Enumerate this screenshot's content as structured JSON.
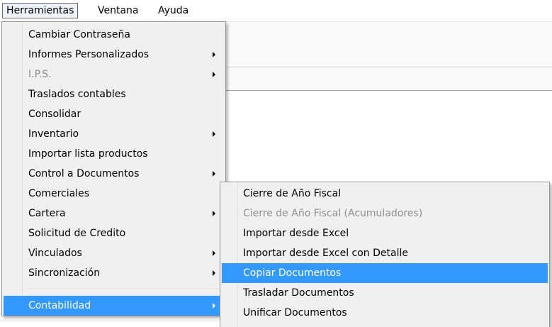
{
  "menubar": {
    "items": [
      {
        "label": "Herramientas"
      },
      {
        "label": "Ventana"
      },
      {
        "label": "Ayuda"
      }
    ]
  },
  "herramientas_menu": {
    "items": [
      {
        "label": "Cambiar Contraseña",
        "submenu": false,
        "disabled": false
      },
      {
        "label": "Informes Personalizados",
        "submenu": true,
        "disabled": false
      },
      {
        "label": "I.P.S.",
        "submenu": true,
        "disabled": true
      },
      {
        "label": "Traslados contables",
        "submenu": false,
        "disabled": false
      },
      {
        "label": "Consolidar",
        "submenu": false,
        "disabled": false
      },
      {
        "label": "Inventario",
        "submenu": true,
        "disabled": false
      },
      {
        "label": "Importar lista productos",
        "submenu": false,
        "disabled": false
      },
      {
        "label": "Control a Documentos",
        "submenu": true,
        "disabled": false
      },
      {
        "label": "Comerciales",
        "submenu": false,
        "disabled": false
      },
      {
        "label": "Cartera",
        "submenu": true,
        "disabled": false
      },
      {
        "label": "Solicitud de Credito",
        "submenu": false,
        "disabled": false
      },
      {
        "label": "Vinculados",
        "submenu": true,
        "disabled": false
      },
      {
        "label": "Sincronización",
        "submenu": true,
        "disabled": false
      },
      {
        "label": "Contabilidad",
        "submenu": true,
        "disabled": false,
        "highlighted": true
      }
    ]
  },
  "contabilidad_submenu": {
    "items": [
      {
        "label": "Cierre de Año Fiscal",
        "disabled": false
      },
      {
        "label": "Cierre de Año Fiscal (Acumuladores)",
        "disabled": true
      },
      {
        "label": "Importar desde Excel",
        "disabled": false
      },
      {
        "label": "Importar desde Excel con Detalle",
        "disabled": false
      },
      {
        "label": "Copiar Documentos",
        "disabled": false,
        "highlighted": true
      },
      {
        "label": "Trasladar Documentos",
        "disabled": false
      },
      {
        "label": "Unificar Documentos",
        "disabled": false
      }
    ]
  },
  "colors": {
    "highlight": "#3399ff",
    "menu_bg": "#f0f0f0",
    "disabled_text": "#8f8f8f"
  }
}
